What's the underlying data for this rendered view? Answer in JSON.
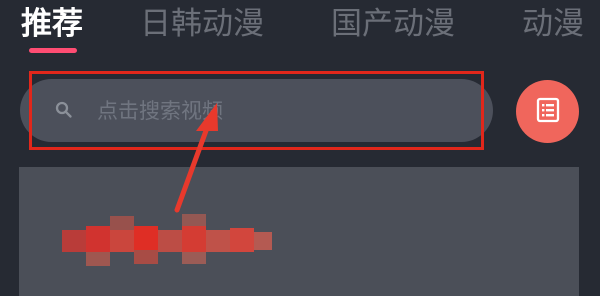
{
  "tabs": [
    {
      "label": "推荐",
      "active": true
    },
    {
      "label": "日韩动漫",
      "active": false
    },
    {
      "label": "国产动漫",
      "active": false
    },
    {
      "label": "动漫",
      "active": false
    }
  ],
  "search": {
    "placeholder": "点击搜索视频",
    "icon": "search-icon"
  },
  "menu_button": {
    "icon": "list-icon"
  },
  "colors": {
    "background": "#262a33",
    "active_tab": "#ffffff",
    "inactive_tab": "#6b6f78",
    "accent": "#ff4d73",
    "search_bg": "#4c505b",
    "highlight": "#e1271b",
    "menu_bg": "#f0665c",
    "card_bg": "#4b4f58"
  }
}
